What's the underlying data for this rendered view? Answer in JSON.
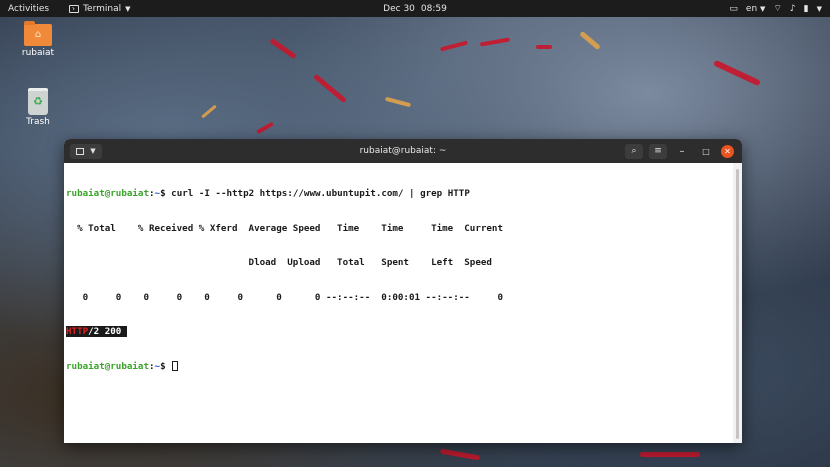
{
  "topbar": {
    "activities": "Activities",
    "app_name": "Terminal",
    "date": "Dec 30",
    "time": "08:59",
    "lang": "en"
  },
  "desktop": {
    "icons": [
      {
        "label": "rubaiat",
        "icon": "home-folder-icon"
      },
      {
        "label": "Trash",
        "icon": "trash-icon"
      }
    ]
  },
  "window": {
    "title": "rubaiat@rubaiat: ~",
    "prompt_user": "rubaiat@rubaiat",
    "prompt_sep": ":",
    "prompt_path": "~",
    "prompt_end": "$ ",
    "command": "curl -I --http2 https://www.ubuntupit.com/ | grep HTTP",
    "output": [
      "  % Total    % Received % Xferd  Average Speed   Time    Time     Time  Current",
      "                                 Dload  Upload   Total   Spent    Left  Speed",
      "   0     0    0     0    0     0      0      0 --:--:--  0:00:01 --:--:--     0"
    ],
    "match_highlight": "HTTP",
    "match_rest": "/2 200 "
  },
  "colors": {
    "prompt_user": "#3aa42a",
    "prompt_path": "#2b55c7",
    "match": "#e02020",
    "close_button": "#e95420",
    "folder": "#f08a3a"
  }
}
